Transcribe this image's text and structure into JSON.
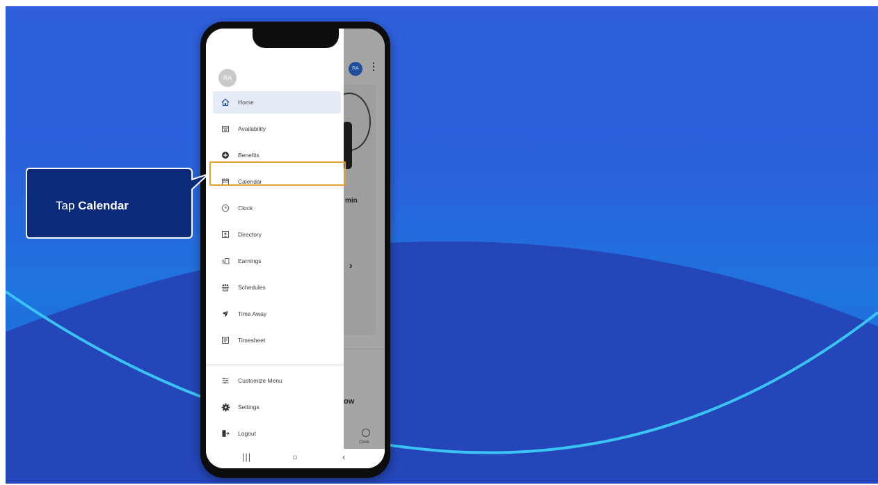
{
  "callout": {
    "prefix": "Tap ",
    "target": "Calendar"
  },
  "drawer": {
    "user_initials": "RA",
    "items": [
      {
        "label": "Home",
        "icon": "home-icon",
        "active": true
      },
      {
        "label": "Availability",
        "icon": "availability-icon",
        "active": false
      },
      {
        "label": "Benefits",
        "icon": "benefits-icon",
        "active": false
      },
      {
        "label": "Calendar",
        "icon": "calendar-icon",
        "active": false
      },
      {
        "label": "Clock",
        "icon": "clock-icon",
        "active": false
      },
      {
        "label": "Directory",
        "icon": "directory-icon",
        "active": false
      },
      {
        "label": "Earnings",
        "icon": "earnings-icon",
        "active": false
      },
      {
        "label": "Schedules",
        "icon": "schedules-icon",
        "active": false
      },
      {
        "label": "Time Away",
        "icon": "airplane-icon",
        "active": false
      },
      {
        "label": "Timesheet",
        "icon": "timesheet-icon",
        "active": false
      }
    ],
    "footer_items": [
      {
        "label": "Customize Menu",
        "icon": "sliders-icon"
      },
      {
        "label": "Settings",
        "icon": "gear-icon"
      },
      {
        "label": "Logout",
        "icon": "logout-icon"
      }
    ]
  },
  "background_app": {
    "user_initials": "RA",
    "partial_name": "min",
    "partial_button": "ow",
    "tab_label": "Clock"
  },
  "navbar": {
    "recents": "|||",
    "home": "○",
    "back": "‹"
  },
  "colors": {
    "highlight": "#e0a22a",
    "callout_bg": "#0c2a7a",
    "active_item": "#e6ecf7"
  }
}
